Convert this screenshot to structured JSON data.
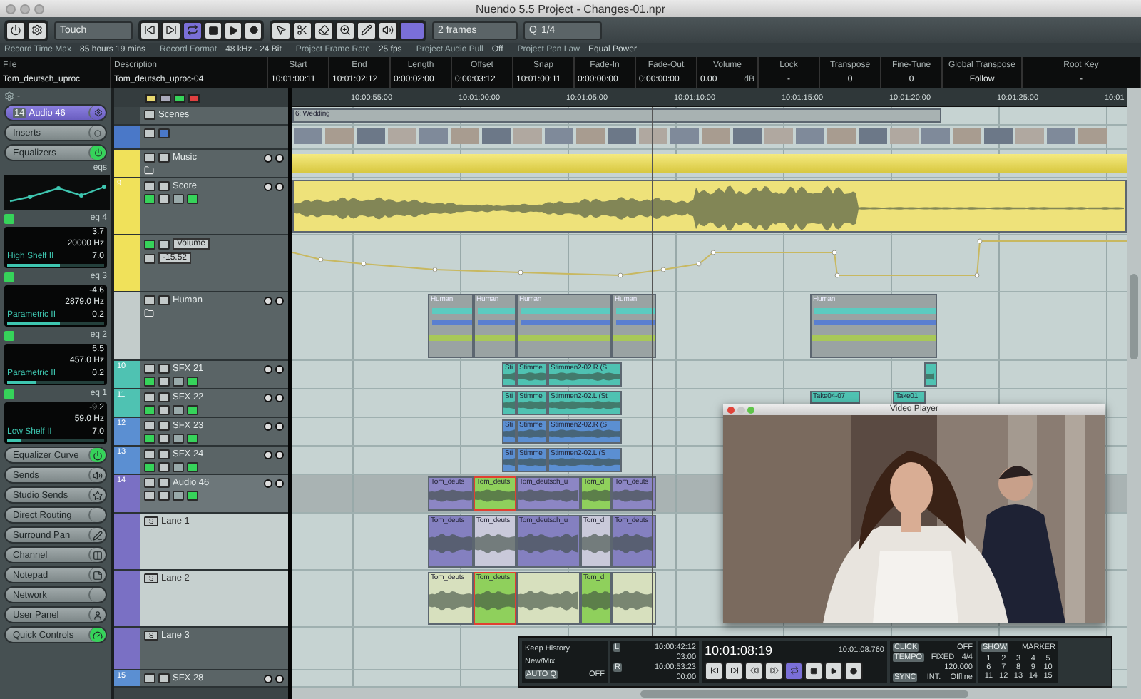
{
  "window": {
    "title": "Nuendo 5.5 Project - Changes-01.npr"
  },
  "toolbar": {
    "automation_mode": "Touch",
    "grid": "2 frames",
    "quantize_label": "Q",
    "quantize": "1/4"
  },
  "status_line": [
    {
      "label": "Record Time Max",
      "value": "85 hours 19 mins"
    },
    {
      "label": "Record Format",
      "value": "48 kHz - 24 Bit"
    },
    {
      "label": "Project Frame Rate",
      "value": "25 fps"
    },
    {
      "label": "Project Audio Pull",
      "value": "Off"
    },
    {
      "label": "Project Pan Law",
      "value": "Equal Power"
    }
  ],
  "info_line": [
    {
      "label": "File",
      "value": "Tom_deutsch_uproc"
    },
    {
      "label": "Description",
      "value": "Tom_deutsch_uproc-04"
    },
    {
      "label": "Start",
      "value": "10:01:00:11"
    },
    {
      "label": "End",
      "value": "10:01:02:12"
    },
    {
      "label": "Length",
      "value": "0:00:02:00"
    },
    {
      "label": "Offset",
      "value": "0:00:03:12"
    },
    {
      "label": "Snap",
      "value": "10:01:00:11"
    },
    {
      "label": "Fade-In",
      "value": "0:00:00:00"
    },
    {
      "label": "Fade-Out",
      "value": "0:00:00:00"
    },
    {
      "label": "Volume",
      "value": "0.00",
      "unit": "dB"
    },
    {
      "label": "Lock",
      "value": "-"
    },
    {
      "label": "Transpose",
      "value": "0"
    },
    {
      "label": "Fine-Tune",
      "value": "0"
    },
    {
      "label": "Global Transpose",
      "value": "Follow"
    },
    {
      "label": "Root Key",
      "value": "-"
    }
  ],
  "ruler": [
    "10:00:55:00",
    "10:01:00:00",
    "10:01:05:00",
    "10:01:10:00",
    "10:01:15:00",
    "10:01:20:00",
    "10:01:25:00",
    "10:01"
  ],
  "inspector": {
    "preset": "-",
    "track_number": "14",
    "track_name": "Audio 46",
    "inserts": "Inserts",
    "equalizers": "Equalizers",
    "eq_label": "eqs",
    "eq_bands": [
      {
        "name": "eq 4",
        "gain": "3.7",
        "freq": "20000 Hz",
        "type": "High Shelf II",
        "q": "7.0",
        "level": 0.55
      },
      {
        "name": "eq 3",
        "gain": "-4.6",
        "freq": "2879.0 Hz",
        "type": "Parametric II",
        "q": "0.2",
        "level": 0.55
      },
      {
        "name": "eq 2",
        "gain": "6.5",
        "freq": "457.0 Hz",
        "type": "Parametric II",
        "q": "0.2",
        "level": 0.3
      },
      {
        "name": "eq 1",
        "gain": "-9.2",
        "freq": "59.0 Hz",
        "type": "Low Shelf II",
        "q": "7.0",
        "level": 0.15
      }
    ],
    "sections": [
      {
        "label": "Equalizer Curve",
        "kind": "power",
        "on": true
      },
      {
        "label": "Sends",
        "kind": "sends",
        "on": false
      },
      {
        "label": "Studio Sends",
        "kind": "star",
        "on": false
      },
      {
        "label": "Direct Routing",
        "kind": "none",
        "on": false
      },
      {
        "label": "Surround Pan",
        "kind": "edit",
        "on": false
      },
      {
        "label": "Channel",
        "kind": "channel",
        "on": false
      },
      {
        "label": "Notepad",
        "kind": "note",
        "on": false
      },
      {
        "label": "Network",
        "kind": "none",
        "on": false
      },
      {
        "label": "User Panel",
        "kind": "user",
        "on": false
      },
      {
        "label": "Quick Controls",
        "kind": "knob",
        "on": true
      }
    ]
  },
  "tracks": [
    {
      "kind": "marker",
      "name": "Scenes",
      "selected": false,
      "events": [
        {
          "label": "6: Wedding"
        }
      ]
    },
    {
      "kind": "video",
      "selected": false
    },
    {
      "kind": "folder",
      "name": "Music",
      "color": "#f0e15a",
      "selected": false
    },
    {
      "kind": "audio",
      "number": "9",
      "name": "Score",
      "color": "#f0e15a",
      "read": true,
      "selected": false,
      "events": [
        {
          "color": "#eee27a",
          "selected": false
        }
      ]
    },
    {
      "kind": "automation",
      "name": "Volume",
      "value": "-15.52",
      "color": "#f0e15a",
      "selected": false
    },
    {
      "kind": "folder",
      "name": "Human",
      "color": "#c3cccb",
      "selected": false,
      "events": [
        {
          "label": "Human"
        },
        {
          "label": "Human"
        },
        {
          "label": "Human"
        },
        {
          "label": "Human"
        },
        {
          "label": "Human"
        }
      ]
    },
    {
      "kind": "audio",
      "number": "10",
      "name": "SFX 21",
      "color": "#4fc2b2",
      "read": true,
      "selected": false,
      "events": [
        {
          "label": "Sti",
          "color": "#4fc2b2",
          "selected": false
        },
        {
          "label": "Stimme",
          "color": "#4fc2b2",
          "selected": false
        },
        {
          "label": "Stimmen2-02.R (S",
          "color": "#4fc2b2",
          "selected": false
        },
        {
          "color": "#4fc2b2",
          "selected": false
        }
      ]
    },
    {
      "kind": "audio",
      "number": "11",
      "name": "SFX 22",
      "color": "#4fc2b2",
      "read": true,
      "selected": false,
      "events": [
        {
          "label": "Sti",
          "color": "#4fc2b2",
          "selected": false
        },
        {
          "label": "Stimme",
          "color": "#4fc2b2",
          "selected": false
        },
        {
          "label": "Stimmen2-02.L (St",
          "color": "#4fc2b2",
          "selected": false
        },
        {
          "label": "Take04-07",
          "color": "#4fc2b2",
          "selected": false
        },
        {
          "label": "Take01",
          "color": "#4fc2b2",
          "selected": false
        }
      ]
    },
    {
      "kind": "audio",
      "number": "12",
      "name": "SFX 23",
      "color": "#5b8fd2",
      "read": true,
      "selected": false,
      "events": [
        {
          "label": "Sti",
          "color": "#5b8fd2",
          "selected": false
        },
        {
          "label": "Stimme",
          "color": "#5b8fd2",
          "selected": false
        },
        {
          "label": "Stimmen2-02.R (S",
          "color": "#5b8fd2",
          "selected": false
        }
      ]
    },
    {
      "kind": "audio",
      "number": "13",
      "name": "SFX 24",
      "color": "#5b8fd2",
      "read": true,
      "selected": false,
      "events": [
        {
          "label": "Sti",
          "color": "#5b8fd2",
          "selected": false
        },
        {
          "label": "Stimme",
          "color": "#5b8fd2",
          "selected": false
        },
        {
          "label": "Stimmen2-02.L (S",
          "color": "#5b8fd2",
          "selected": false
        }
      ]
    },
    {
      "kind": "audio",
      "number": "14",
      "name": "Audio 46",
      "color": "#7a70c4",
      "read": false,
      "selected": true,
      "events": [
        {
          "label": "Tom_deuts",
          "color": "#8c86c4",
          "selected": false
        },
        {
          "label": "Tom_deuts",
          "color": "#8fd05c",
          "selected": true
        },
        {
          "label": "Tom_deutsch_u",
          "color": "#8c86c4",
          "selected": false
        },
        {
          "label": "Tom_d",
          "color": "#8fd05c",
          "selected": false
        },
        {
          "label": "Tom_deuts",
          "color": "#8c86c4",
          "selected": false
        }
      ]
    },
    {
      "kind": "lane",
      "name": "Lane 1",
      "solo_label": "S",
      "color": "#7a70c4",
      "selected": true,
      "events": [
        {
          "label": "Tom_deuts",
          "color": "#8480c0",
          "selected": false
        },
        {
          "label": "Tom_deuts",
          "color": "#c9c9da",
          "selected": false
        },
        {
          "label": "Tom_deutsch_u",
          "color": "#8480c0",
          "selected": false
        },
        {
          "label": "Tom_d",
          "color": "#c9c9da",
          "selected": false
        },
        {
          "label": "Tom_deuts",
          "color": "#8480c0",
          "selected": false
        }
      ]
    },
    {
      "kind": "lane",
      "name": "Lane 2",
      "solo_label": "S",
      "color": "#7a70c4",
      "selected": true,
      "events": [
        {
          "label": "Tom_deuts",
          "color": "#d7e0be",
          "selected": false
        },
        {
          "label": "Tom_deuts",
          "color": "#8fd05c",
          "selected": true
        },
        {
          "color": "#d7e0be",
          "selected": false
        },
        {
          "label": "Tom_d",
          "color": "#8fd05c",
          "selected": false
        },
        {
          "color": "#d7e0be",
          "selected": false
        }
      ]
    },
    {
      "kind": "lane",
      "name": "Lane 3",
      "solo_label": "S",
      "color": "#7a70c4",
      "selected": false
    },
    {
      "kind": "audio",
      "number": "15",
      "name": "SFX 28",
      "color": "#5b8fd2",
      "selected": false
    }
  ],
  "video_player": {
    "title": "Video Player"
  },
  "transport": {
    "history": "Keep History",
    "mode": "New/Mix",
    "auto_q": "AUTO Q",
    "auto_q_value": "OFF",
    "left_label": "L",
    "left": "10:00:42:12",
    "left_sub": "03:00",
    "right_label": "R",
    "right": "10:00:53:23",
    "right_sub": "00:00",
    "position": "10:01:08:19",
    "position_secondary": "10:01:08.760",
    "click_label": "CLICK",
    "click": "OFF",
    "tempo_label": "TEMPO",
    "tempo_mode": "FIXED",
    "signature": "4/4",
    "tempo": "120.000",
    "sync_label": "SYNC",
    "sync": "INT.",
    "sync_state": "Offline",
    "show": "SHOW",
    "marker": "MARKER",
    "markers": [
      "1",
      "2",
      "3",
      "4",
      "5",
      "6",
      "7",
      "8",
      "9",
      "10",
      "11",
      "12",
      "13",
      "14",
      "15"
    ]
  }
}
